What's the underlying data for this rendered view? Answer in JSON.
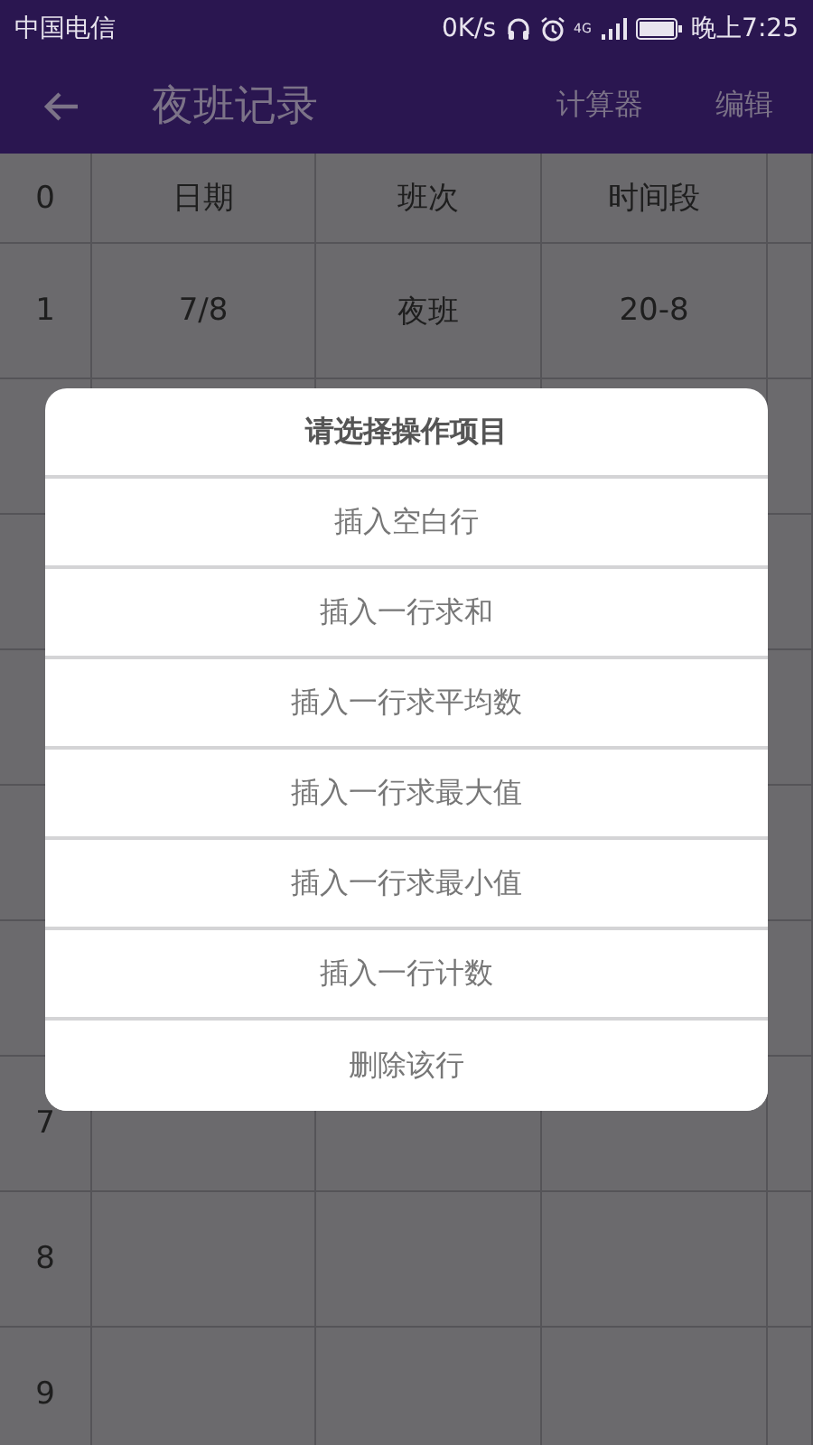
{
  "status_bar": {
    "carrier": "中国电信",
    "speed": "0K/s",
    "network": "4G",
    "time": "晚上7:25"
  },
  "toolbar": {
    "title": "夜班记录",
    "actions": [
      "计算器",
      "编辑"
    ]
  },
  "table": {
    "columns": [
      "0",
      "日期",
      "班次",
      "时间段"
    ],
    "rows": [
      {
        "cells": [
          "1",
          "7/8",
          "夜班",
          "20-8"
        ]
      },
      {
        "cells": []
      },
      {
        "cells": []
      },
      {
        "cells": []
      },
      {
        "cells": []
      },
      {
        "cells": []
      },
      {
        "cells": [
          "7"
        ]
      },
      {
        "cells": [
          "8"
        ]
      },
      {
        "cells": [
          "9"
        ]
      }
    ]
  },
  "dialog": {
    "title": "请选择操作项目",
    "options": [
      "插入空白行",
      "插入一行求和",
      "插入一行求平均数",
      "插入一行求最大值",
      "插入一行求最小值",
      "插入一行计数",
      "删除该行"
    ]
  }
}
